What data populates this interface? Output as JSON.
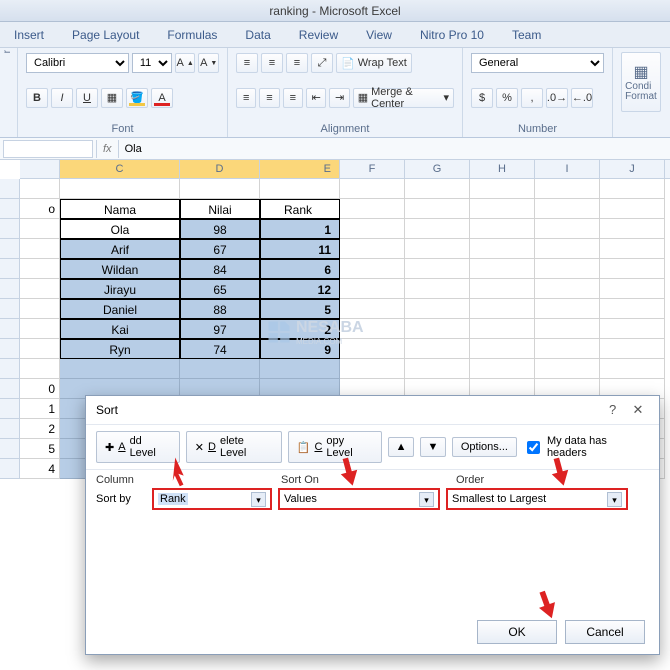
{
  "title": "ranking  -  Microsoft Excel",
  "tabs": [
    "Insert",
    "Page Layout",
    "Formulas",
    "Data",
    "Review",
    "View",
    "Nitro Pro 10",
    "Team"
  ],
  "ribbon": {
    "font": {
      "family": "Calibri",
      "size": "11",
      "label": "Font"
    },
    "alignment": {
      "wrap": "Wrap Text",
      "merge": "Merge & Center",
      "label": "Alignment"
    },
    "number": {
      "format": "General",
      "label": "Number"
    },
    "cond": "Condi\nFormat"
  },
  "formula": {
    "name": "",
    "fx": "fx",
    "value": "Ola"
  },
  "cols": [
    "C",
    "D",
    "E",
    "F",
    "G",
    "H",
    "I",
    "J"
  ],
  "headers": {
    "c": "Nama",
    "d": "Nilai",
    "e": "Rank"
  },
  "data": [
    {
      "c": "Ola",
      "d": "98",
      "e": "1"
    },
    {
      "c": "Arif",
      "d": "67",
      "e": "11"
    },
    {
      "c": "Wildan",
      "d": "84",
      "e": "6"
    },
    {
      "c": "Jirayu",
      "d": "65",
      "e": "12"
    },
    {
      "c": "Daniel",
      "d": "88",
      "e": "5"
    },
    {
      "c": "Kai",
      "d": "97",
      "e": "2"
    },
    {
      "c": "Ryn",
      "d": "74",
      "e": "9"
    }
  ],
  "cutnums": [
    "0",
    "1",
    "2",
    "5",
    "4"
  ],
  "cutcell": "C",
  "dialog": {
    "title": "Sort",
    "add": "Add Level",
    "del": "Delete Level",
    "copy": "Copy Level",
    "opt": "Options...",
    "headers_chk": "My data has headers",
    "colhead": "Column",
    "sortonhead": "Sort On",
    "orderhead": "Order",
    "sortby": "Sort by",
    "col": "Rank",
    "sorton": "Values",
    "order": "Smallest to Largest",
    "ok": "OK",
    "cancel": "Cancel"
  },
  "watermark": "NESABA",
  "watermark2": "MEDIA.COM",
  "bcol_label": "o"
}
